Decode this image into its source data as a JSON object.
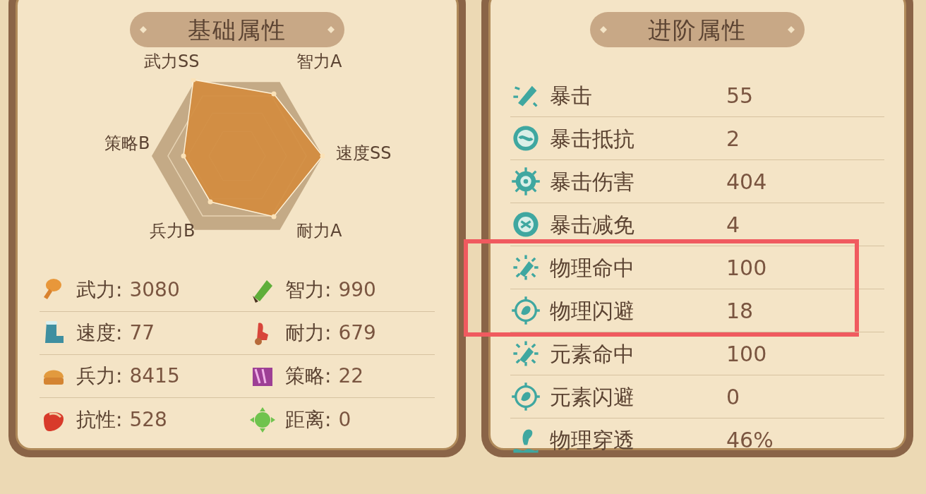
{
  "basic": {
    "title": "基础属性",
    "radar_labels": [
      "武力SS",
      "智力A",
      "速度SS",
      "耐力A",
      "兵力B",
      "策略B"
    ],
    "stats": [
      {
        "label": "武力:",
        "value": "3080"
      },
      {
        "label": "智力:",
        "value": "990"
      },
      {
        "label": "速度:",
        "value": "77"
      },
      {
        "label": "耐力:",
        "value": "679"
      },
      {
        "label": "兵力:",
        "value": "8415"
      },
      {
        "label": "策略:",
        "value": "22"
      },
      {
        "label": "抗性:",
        "value": "528"
      },
      {
        "label": "距离:",
        "value": "0"
      }
    ]
  },
  "advanced": {
    "title": "进阶属性",
    "rows": [
      {
        "label": "暴击",
        "value": "55",
        "highlighted": false
      },
      {
        "label": "暴击抵抗",
        "value": "2",
        "highlighted": false
      },
      {
        "label": "暴击伤害",
        "value": "404",
        "highlighted": false
      },
      {
        "label": "暴击减免",
        "value": "4",
        "highlighted": false
      },
      {
        "label": "物理命中",
        "value": "100",
        "highlighted": true
      },
      {
        "label": "物理闪避",
        "value": "18",
        "highlighted": true
      },
      {
        "label": "元素命中",
        "value": "100",
        "highlighted": false
      },
      {
        "label": "元素闪避",
        "value": "0",
        "highlighted": false
      },
      {
        "label": "物理穿透",
        "value": "46%",
        "highlighted": false
      }
    ]
  }
}
